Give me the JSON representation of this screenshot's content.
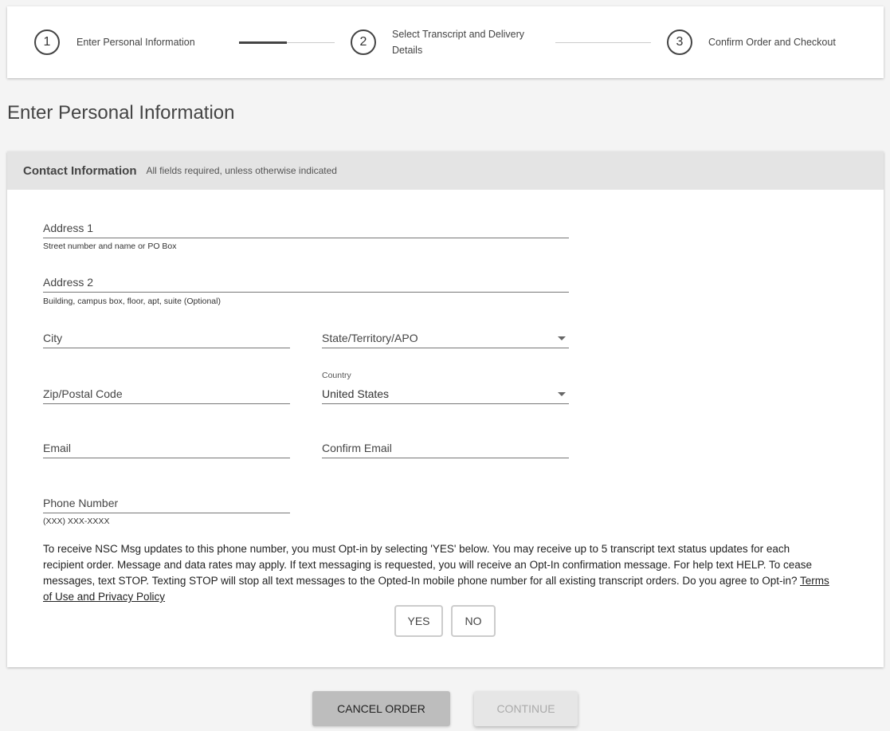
{
  "stepper": {
    "steps": [
      {
        "number": "1",
        "label": "Enter Personal Information"
      },
      {
        "number": "2",
        "label": "Select Transcript and Delivery Details"
      },
      {
        "number": "3",
        "label": "Confirm Order and Checkout"
      }
    ],
    "progress_fraction": 0.5
  },
  "page_title": "Enter Personal Information",
  "contact": {
    "title": "Contact Information",
    "subtitle": "All fields required, unless otherwise indicated",
    "address1": {
      "label": "Address 1",
      "hint": "Street number and name or PO Box"
    },
    "address2": {
      "label": "Address 2",
      "hint": "Building, campus box, floor, apt, suite (Optional)"
    },
    "city": {
      "label": "City"
    },
    "state": {
      "label": "State/Territory/APO"
    },
    "zip": {
      "label": "Zip/Postal Code"
    },
    "country": {
      "label": "Country",
      "value": "United States"
    },
    "email": {
      "label": "Email"
    },
    "confirm_email": {
      "label": "Confirm Email"
    },
    "phone": {
      "label": "Phone Number",
      "hint": "(XXX) XXX-XXXX"
    },
    "optin_text": "To receive NSC Msg updates to this phone number, you must Opt-in by selecting 'YES' below. You may receive up to 5 transcript text status updates for each recipient order. Message and data rates may apply. If text messaging is requested, you will receive an Opt-In confirmation message. For help text HELP. To cease messages, text STOP. Texting STOP will stop all text messages to the Opted-In mobile phone number for all existing transcript orders. Do you agree to Opt-in? ",
    "terms_link": "Terms of Use and Privacy Policy",
    "yes_label": "YES",
    "no_label": "NO"
  },
  "actions": {
    "cancel_label": "CANCEL ORDER",
    "continue_label": "CONTINUE"
  }
}
